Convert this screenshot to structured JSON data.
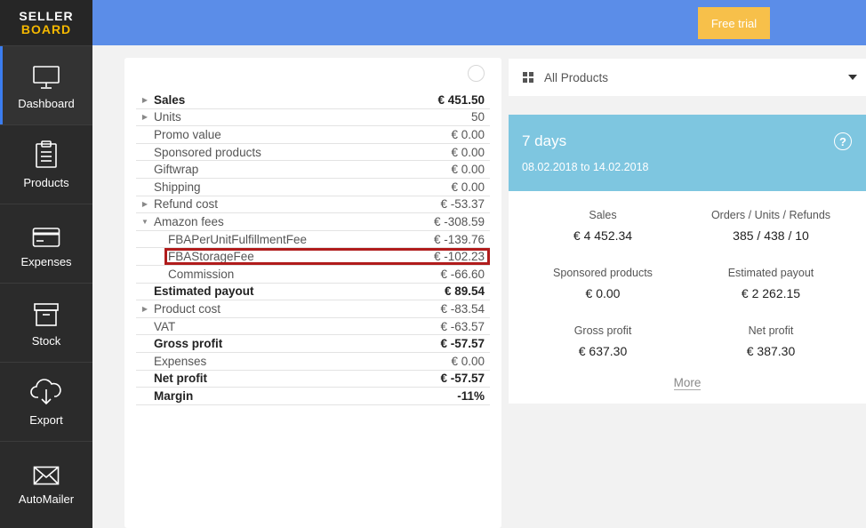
{
  "logo": {
    "line1": "SELLER",
    "line2": "BOARD"
  },
  "sidebar": {
    "items": [
      {
        "label": "Dashboard",
        "icon": "monitor-icon"
      },
      {
        "label": "Products",
        "icon": "clipboard-icon"
      },
      {
        "label": "Expenses",
        "icon": "credit-card-icon"
      },
      {
        "label": "Stock",
        "icon": "box-icon"
      },
      {
        "label": "Export",
        "icon": "cloud-download-icon"
      },
      {
        "label": "AutoMailer",
        "icon": "envelope-icon"
      }
    ]
  },
  "header": {
    "free_trial": "Free trial"
  },
  "pl": {
    "rows": [
      {
        "label": "Sales",
        "value": "€ 451.50"
      },
      {
        "label": "Units",
        "value": "50"
      },
      {
        "label": "Promo value",
        "value": "€ 0.00"
      },
      {
        "label": "Sponsored products",
        "value": "€ 0.00"
      },
      {
        "label": "Giftwrap",
        "value": "€ 0.00"
      },
      {
        "label": "Shipping",
        "value": "€ 0.00"
      },
      {
        "label": "Refund cost",
        "value": "€ -53.37"
      },
      {
        "label": "Amazon fees",
        "value": "€ -308.59"
      },
      {
        "label": "FBAPerUnitFulfillmentFee",
        "value": "€ -139.76"
      },
      {
        "label": "FBAStorageFee",
        "value": "€ -102.23"
      },
      {
        "label": "Commission",
        "value": "€ -66.60"
      },
      {
        "label": "Estimated payout",
        "value": "€ 89.54"
      },
      {
        "label": "Product cost",
        "value": "€ -83.54"
      },
      {
        "label": "VAT",
        "value": "€ -63.57"
      },
      {
        "label": "Gross profit",
        "value": "€ -57.57"
      },
      {
        "label": "Expenses",
        "value": "€ 0.00"
      },
      {
        "label": "Net profit",
        "value": "€ -57.57"
      },
      {
        "label": "Margin",
        "value": "-11%"
      }
    ]
  },
  "product_select": {
    "value": "All Products"
  },
  "period": {
    "title": "7 days",
    "range": "08.02.2018 to 14.02.2018",
    "help": "?",
    "stats": [
      {
        "label": "Sales",
        "value": "€ 4 452.34"
      },
      {
        "label": "Orders / Units / Refunds",
        "value": "385 / 438 / 10"
      },
      {
        "label": "Sponsored products",
        "value": "€ 0.00"
      },
      {
        "label": "Estimated payout",
        "value": "€ 2 262.15"
      },
      {
        "label": "Gross profit",
        "value": "€ 637.30"
      },
      {
        "label": "Net profit",
        "value": "€ 387.30"
      }
    ],
    "more": "More"
  },
  "colors": {
    "sidebar": "#2b2b2b",
    "header": "#5b8de8",
    "free_trial": "#f7c04a",
    "period_header": "#7ec6e0",
    "highlight_border": "#b01c1c",
    "logo_accent": "#f5b800"
  }
}
